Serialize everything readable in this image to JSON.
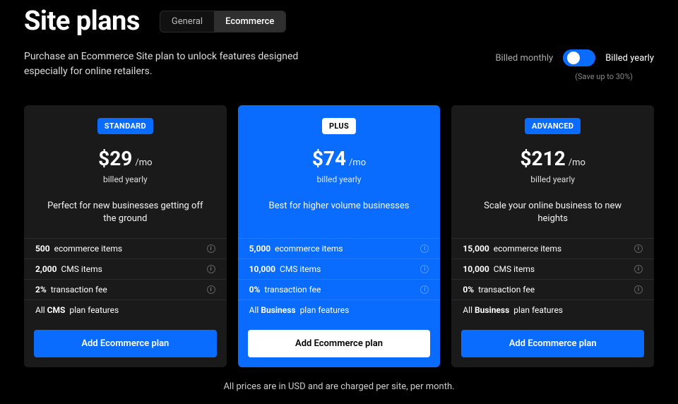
{
  "header": {
    "title": "Site plans",
    "tabs": [
      "General",
      "Ecommerce"
    ],
    "active_tab": 1
  },
  "subhead": {
    "description": "Purchase an Ecommerce Site plan to unlock features designed especially for online retailers.",
    "billing_monthly": "Billed monthly",
    "billing_yearly": "Billed yearly",
    "save_note": "(Save up to 30%)"
  },
  "plans": [
    {
      "badge": "STANDARD",
      "price": "$29",
      "per": "/mo",
      "billed": "billed yearly",
      "tagline": "Perfect for new businesses getting off the ground",
      "features": [
        {
          "bold": "500",
          "rest": "ecommerce items",
          "info": true
        },
        {
          "bold": "2,000",
          "rest": "CMS items",
          "info": true
        },
        {
          "bold": "2%",
          "rest": "transaction fee",
          "info": true
        },
        {
          "bold_pre": "All ",
          "bold": "CMS",
          "rest": "plan features",
          "info": false
        }
      ],
      "cta": "Add Ecommerce plan"
    },
    {
      "badge": "PLUS",
      "price": "$74",
      "per": "/mo",
      "billed": "billed yearly",
      "tagline": "Best for higher volume businesses",
      "features": [
        {
          "bold": "5,000",
          "rest": "ecommerce items",
          "info": true
        },
        {
          "bold": "10,000",
          "rest": "CMS items",
          "info": true
        },
        {
          "bold": "0%",
          "rest": "transaction fee",
          "info": true
        },
        {
          "bold_pre": "All ",
          "bold": "Business",
          "rest": "plan features",
          "info": false
        }
      ],
      "cta": "Add Ecommerce plan"
    },
    {
      "badge": "ADVANCED",
      "price": "$212",
      "per": "/mo",
      "billed": "billed yearly",
      "tagline": "Scale your online business to new heights",
      "features": [
        {
          "bold": "15,000",
          "rest": "ecommerce items",
          "info": true
        },
        {
          "bold": "10,000",
          "rest": "CMS items",
          "info": true
        },
        {
          "bold": "0%",
          "rest": "transaction fee",
          "info": true
        },
        {
          "bold_pre": "All ",
          "bold": "Business",
          "rest": "plan features",
          "info": false
        }
      ],
      "cta": "Add Ecommerce plan"
    }
  ],
  "footnote": "All prices are in USD and are charged per site, per month."
}
